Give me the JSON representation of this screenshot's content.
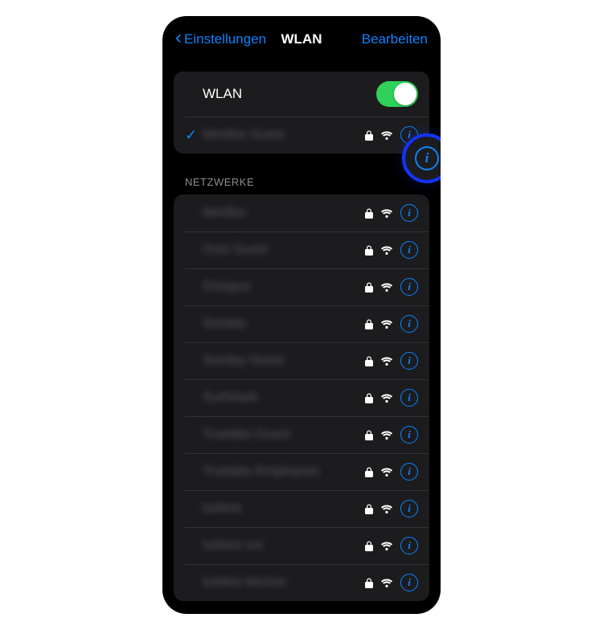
{
  "nav": {
    "back_label": "Einstellungen",
    "title": "WLAN",
    "edit_label": "Bearbeiten"
  },
  "wlan_toggle": {
    "label": "WLAN",
    "on": true
  },
  "connected": {
    "name": "Nerdloc Guest"
  },
  "section_networks_label": "NETZWERKE",
  "networks": [
    {
      "name": "Nerdloc"
    },
    {
      "name": "Octo Guest"
    },
    {
      "name": "Octopus"
    },
    {
      "name": "Sunday"
    },
    {
      "name": "Sunday Guest"
    },
    {
      "name": "Surfshark"
    },
    {
      "name": "Truelabs Guest"
    },
    {
      "name": "Truelabs Employees"
    },
    {
      "name": "turbine"
    },
    {
      "name": "turbine ext"
    },
    {
      "name": "turbine kitchen"
    }
  ]
}
